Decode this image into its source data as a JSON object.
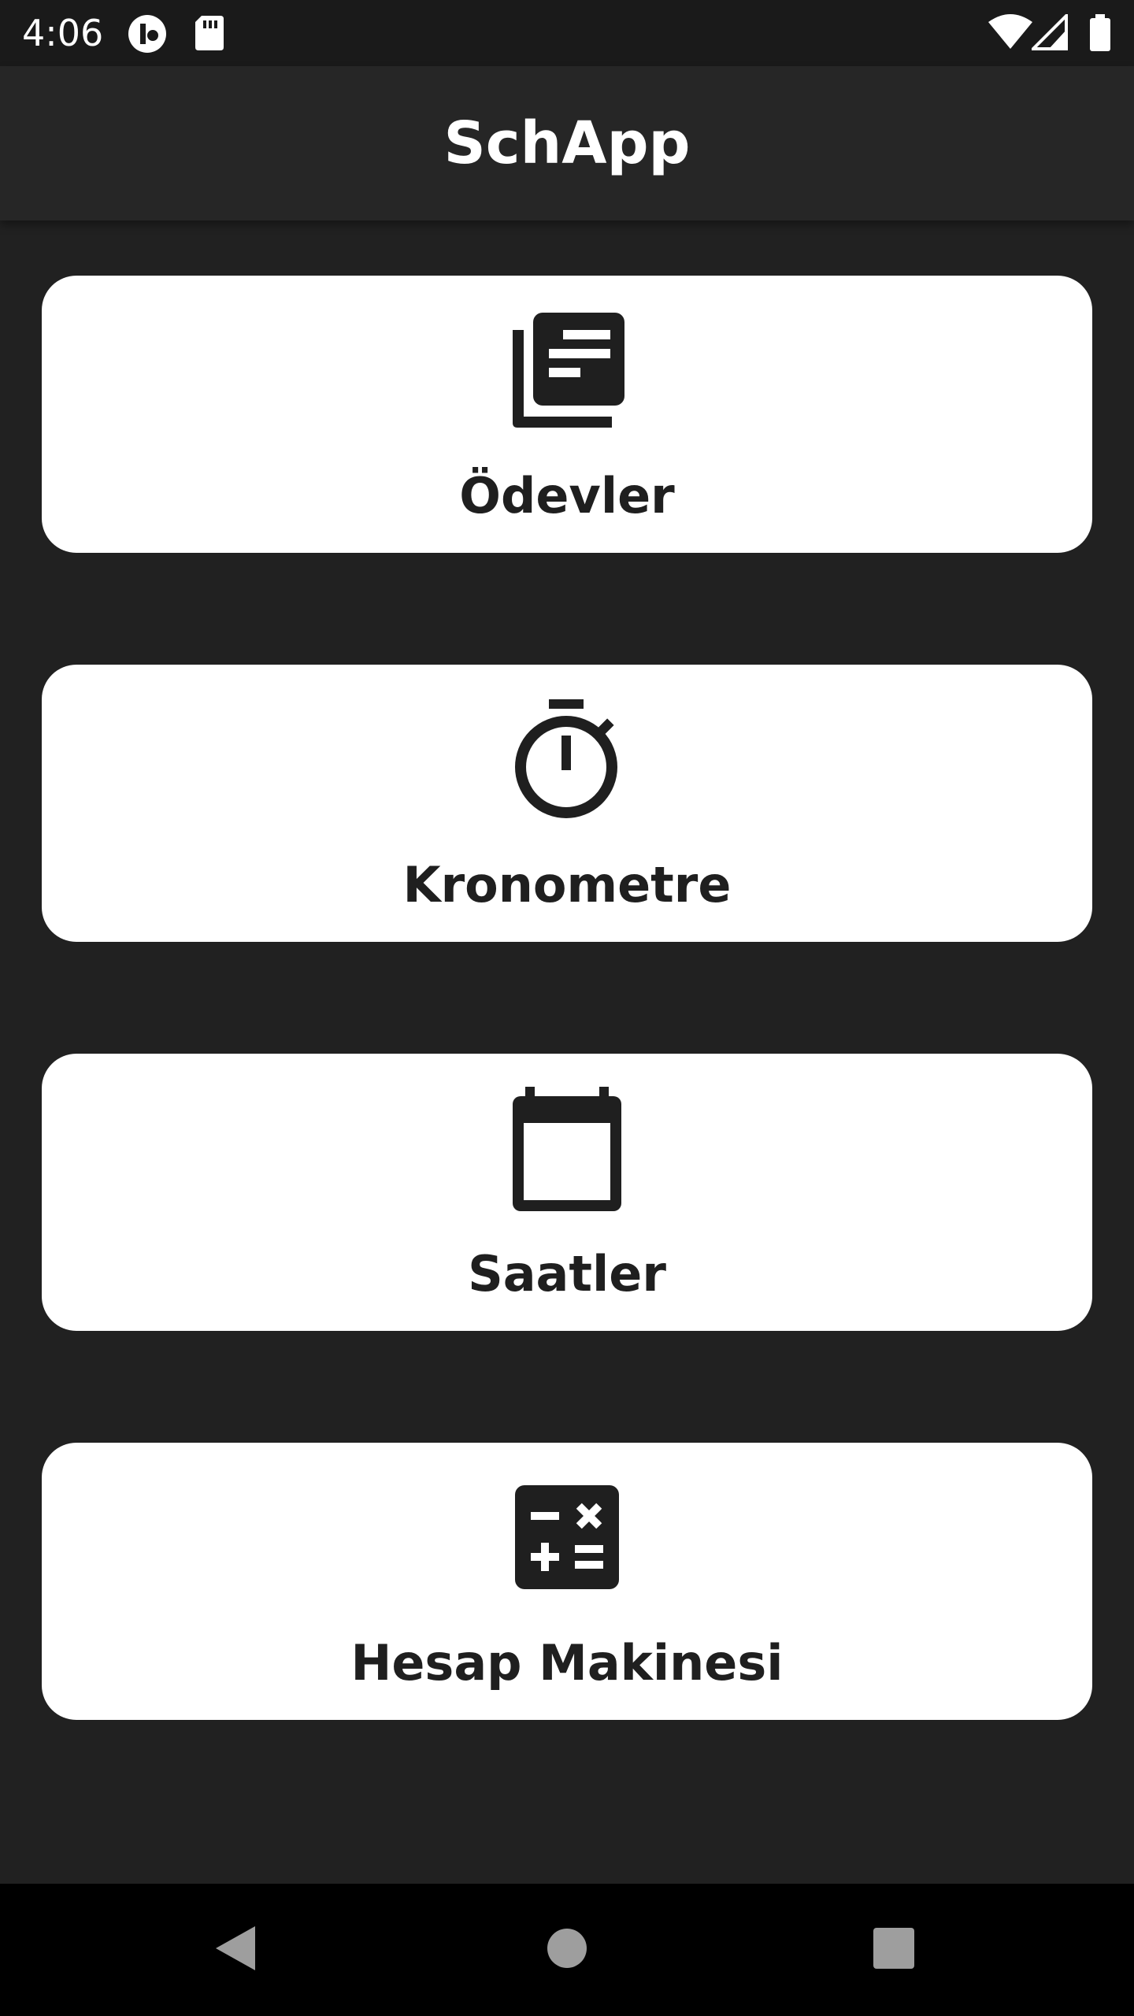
{
  "status_bar": {
    "time": "4:06",
    "icons": [
      "app-notification-icon",
      "sd-card-icon",
      "wifi-icon",
      "cell-signal-icon",
      "battery-icon"
    ]
  },
  "app_bar": {
    "title": "SchApp"
  },
  "menu": {
    "items": [
      {
        "label": "Ödevler",
        "icon": "newspaper-icon"
      },
      {
        "label": "Kronometre",
        "icon": "stopwatch-icon"
      },
      {
        "label": "Saatler",
        "icon": "calendar-icon"
      },
      {
        "label": "Hesap Makinesi",
        "icon": "calculator-icon"
      }
    ]
  },
  "nav_bar": {
    "buttons": [
      "back-icon",
      "home-icon",
      "recents-icon"
    ]
  },
  "colors": {
    "background": "#212121",
    "app_bar": "#262626",
    "card": "#ffffff",
    "icon": "#1f1f1f",
    "text_light": "#ffffff",
    "nav_bar": "#000000"
  }
}
